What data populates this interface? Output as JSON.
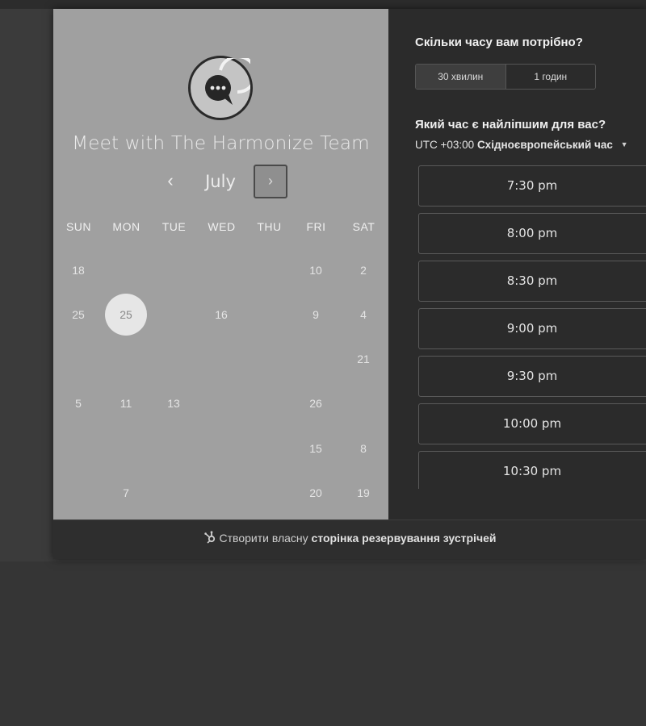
{
  "organizer": {
    "title": "Meet with The Harmonize Team",
    "avatar_icon": "chat-bubble-icon"
  },
  "calendar": {
    "month": "July",
    "prev_icon": "‹",
    "next_icon": "›",
    "weekdays": [
      "SUN",
      "MON",
      "TUE",
      "WED",
      "THU",
      "FRI",
      "SAT"
    ],
    "weeks": [
      [
        "18",
        "",
        "",
        "",
        "",
        "10",
        "2"
      ],
      [
        "25",
        "25",
        "",
        "16",
        "",
        "9",
        "4"
      ],
      [
        "",
        "",
        "",
        "",
        "",
        "",
        "21"
      ],
      [
        "5",
        "11",
        "13",
        "",
        "",
        "26",
        ""
      ],
      [
        "",
        "",
        "",
        "",
        "",
        "15",
        "8"
      ],
      [
        "",
        "7",
        "",
        "",
        "",
        "20",
        "19"
      ]
    ],
    "selected": {
      "week": 1,
      "day": 1
    }
  },
  "duration": {
    "question": "Скільки часу вам потрібно?",
    "options": [
      "30 хвилин",
      "1 годин"
    ],
    "selected": "30 хвилин"
  },
  "time": {
    "question": "Який час є найліпшим для вас?",
    "timezone_offset": "UTC +03:00",
    "timezone_name": "Східноєвропейський час",
    "slots": [
      "7:30 pm",
      "8:00 pm",
      "8:30 pm",
      "9:00 pm",
      "9:30 pm",
      "10:00 pm",
      "10:30 pm"
    ]
  },
  "footer": {
    "prefix": "Створити власну",
    "link": "сторінка резервування зустрічей",
    "icon": "hubspot-sprocket-icon"
  },
  "colors": {
    "left_panel_bg": "#a0a0a0",
    "right_panel_bg": "#2b2b2b",
    "selected_day_bg": "#e6e6e6"
  }
}
